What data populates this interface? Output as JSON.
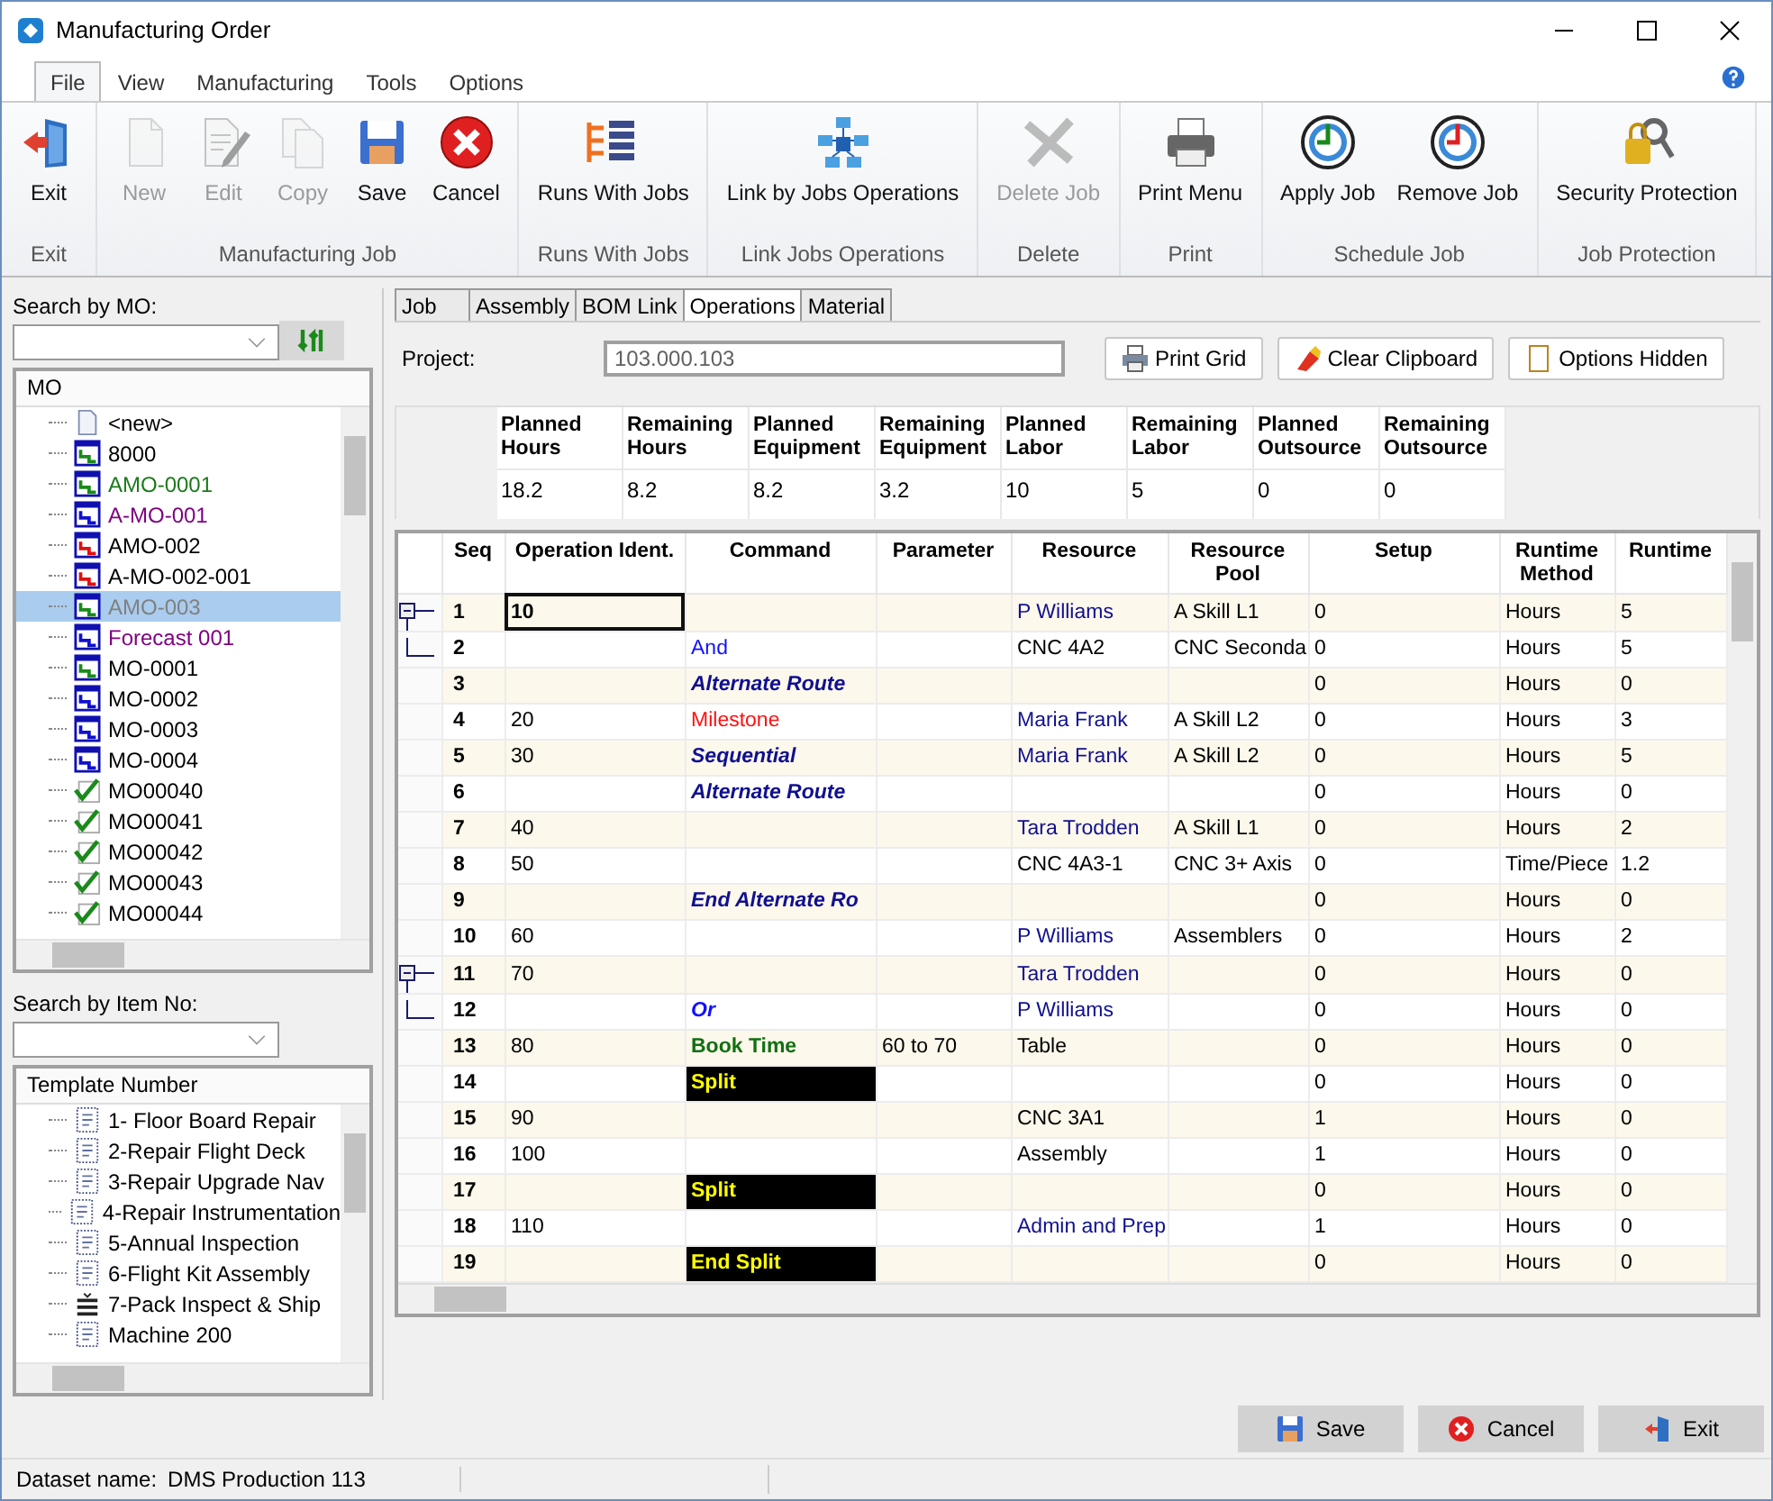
{
  "window": {
    "title": "Manufacturing Order"
  },
  "ribbon_tabs": [
    {
      "label": "File",
      "selected": true
    },
    {
      "label": "View",
      "selected": false
    },
    {
      "label": "Manufacturing",
      "selected": false
    },
    {
      "label": "Tools",
      "selected": false
    },
    {
      "label": "Options",
      "selected": false
    }
  ],
  "ribbon_groups": [
    {
      "label": "Exit",
      "buttons": [
        {
          "label": "Exit",
          "disabled": false
        }
      ]
    },
    {
      "label": "Manufacturing Job",
      "buttons": [
        {
          "label": "New",
          "disabled": true
        },
        {
          "label": "Edit",
          "disabled": true
        },
        {
          "label": "Copy",
          "disabled": true
        },
        {
          "label": "Save",
          "disabled": false
        },
        {
          "label": "Cancel",
          "disabled": false
        }
      ]
    },
    {
      "label": "Runs With Jobs",
      "buttons": [
        {
          "label": "Runs With Jobs",
          "disabled": false
        }
      ]
    },
    {
      "label": "Link Jobs Operations",
      "buttons": [
        {
          "label": "Link by Jobs Operations",
          "disabled": false
        }
      ]
    },
    {
      "label": "Delete",
      "buttons": [
        {
          "label": "Delete Job",
          "disabled": true
        }
      ]
    },
    {
      "label": "Print",
      "buttons": [
        {
          "label": "Print Menu",
          "disabled": false
        }
      ]
    },
    {
      "label": "Schedule Job",
      "buttons": [
        {
          "label": "Apply Job",
          "disabled": false
        },
        {
          "label": "Remove Job",
          "disabled": false
        }
      ]
    },
    {
      "label": "Job Protection",
      "buttons": [
        {
          "label": "Security Protection",
          "disabled": false
        }
      ]
    }
  ],
  "mo_search": {
    "label": "Search by MO:"
  },
  "mo_tree": {
    "header": "MO",
    "items": [
      {
        "label": "<new>",
        "kind": "new",
        "color": "#000000",
        "selected": false
      },
      {
        "label": "8000",
        "kind": "green",
        "color": "#000000",
        "selected": false
      },
      {
        "label": "AMO-0001",
        "kind": "green",
        "color": "#1a7a1a",
        "selected": false
      },
      {
        "label": "A-MO-001",
        "kind": "blue",
        "color": "#800080",
        "selected": false
      },
      {
        "label": "AMO-002",
        "kind": "red",
        "color": "#000000",
        "selected": false
      },
      {
        "label": "A-MO-002-001",
        "kind": "red",
        "color": "#000000",
        "selected": false
      },
      {
        "label": "AMO-003",
        "kind": "green",
        "color": "#808080",
        "selected": true
      },
      {
        "label": "Forecast 001",
        "kind": "blue",
        "color": "#800080",
        "selected": false
      },
      {
        "label": "MO-0001",
        "kind": "green",
        "color": "#000000",
        "selected": false
      },
      {
        "label": "MO-0002",
        "kind": "blue",
        "color": "#000000",
        "selected": false
      },
      {
        "label": "MO-0003",
        "kind": "blue",
        "color": "#000000",
        "selected": false
      },
      {
        "label": "MO-0004",
        "kind": "blue",
        "color": "#000000",
        "selected": false
      },
      {
        "label": "MO00040",
        "kind": "done",
        "color": "#000000",
        "selected": false
      },
      {
        "label": "MO00041",
        "kind": "done",
        "color": "#000000",
        "selected": false
      },
      {
        "label": "MO00042",
        "kind": "done",
        "color": "#000000",
        "selected": false
      },
      {
        "label": "MO00043",
        "kind": "done",
        "color": "#000000",
        "selected": false
      },
      {
        "label": "MO00044",
        "kind": "done",
        "color": "#000000",
        "selected": false
      }
    ]
  },
  "item_search": {
    "label": "Search by Item No:"
  },
  "template_tree": {
    "header": "Template Number",
    "items": [
      {
        "label": "1- Floor Board Repair",
        "kind": "template"
      },
      {
        "label": "2-Repair Flight Deck",
        "kind": "template"
      },
      {
        "label": "3-Repair Upgrade Nav",
        "kind": "template"
      },
      {
        "label": "4-Repair Instrumentation",
        "kind": "template"
      },
      {
        "label": "5-Annual Inspection",
        "kind": "template"
      },
      {
        "label": "6-Flight Kit Assembly",
        "kind": "template"
      },
      {
        "label": "7-Pack Inspect & Ship",
        "kind": "pack"
      },
      {
        "label": "Machine 200",
        "kind": "template"
      }
    ]
  },
  "tabs": [
    {
      "label": "Job",
      "selected": false
    },
    {
      "label": "Assembly",
      "selected": false
    },
    {
      "label": "BOM Link",
      "selected": false
    },
    {
      "label": "Operations",
      "selected": true
    },
    {
      "label": "Material",
      "selected": false
    }
  ],
  "project": {
    "label": "Project:",
    "value": "103.000.103"
  },
  "tool_buttons": [
    "Print Grid",
    "Clear Clipboard",
    "Options Hidden"
  ],
  "summary": [
    {
      "header": "Planned Hours",
      "value": "18.2"
    },
    {
      "header": "Remaining Hours",
      "value": "8.2"
    },
    {
      "header": "Planned Equipment",
      "value": "8.2"
    },
    {
      "header": "Remaining Equipment",
      "value": "3.2"
    },
    {
      "header": "Planned Labor",
      "value": "10"
    },
    {
      "header": "Remaining Labor",
      "value": "5"
    },
    {
      "header": "Planned Outsource",
      "value": "0"
    },
    {
      "header": "Remaining Outsource",
      "value": "0"
    }
  ],
  "grid": {
    "columns": [
      "Seq",
      "Operation Ident.",
      "Command",
      "Parameter",
      "Resource",
      "Resource Pool",
      "Setup",
      "Runtime Method",
      "Runtime"
    ],
    "rows": [
      {
        "seq": "1",
        "op": "10",
        "resource": {
          "text": "P Williams",
          "kind": "person"
        },
        "pool": "A Skill L1",
        "setup": "0",
        "method": "Hours",
        "runtime": "5",
        "kind": "parent",
        "selected": true
      },
      {
        "seq": "2",
        "command": {
          "text": "And",
          "kind": "link"
        },
        "resource": {
          "text": "CNC 4A2",
          "kind": "machine"
        },
        "pool": "CNC Seconda",
        "setup": "0",
        "method": "Hours",
        "runtime": "5",
        "kind": "child",
        "selected": false
      },
      {
        "seq": "3",
        "command": {
          "text": "Alternate Route",
          "kind": "route"
        },
        "setup": "0",
        "method": "Hours",
        "runtime": "0",
        "selected": false
      },
      {
        "seq": "4",
        "op": "20",
        "command": {
          "text": "Milestone",
          "kind": "milestone"
        },
        "resource": {
          "text": "Maria Frank",
          "kind": "person"
        },
        "pool": "A Skill L2",
        "setup": "0",
        "method": "Hours",
        "runtime": "3",
        "selected": false
      },
      {
        "seq": "5",
        "op": "30",
        "command": {
          "text": "Sequential",
          "kind": "route"
        },
        "resource": {
          "text": "Maria Frank",
          "kind": "person"
        },
        "pool": "A Skill L2",
        "setup": "0",
        "method": "Hours",
        "runtime": "5",
        "selected": false
      },
      {
        "seq": "6",
        "command": {
          "text": "Alternate Route",
          "kind": "route"
        },
        "setup": "0",
        "method": "Hours",
        "runtime": "0",
        "selected": false
      },
      {
        "seq": "7",
        "op": "40",
        "resource": {
          "text": "Tara Trodden",
          "kind": "person"
        },
        "pool": "A Skill L1",
        "setup": "0",
        "method": "Hours",
        "runtime": "2",
        "selected": false
      },
      {
        "seq": "8",
        "op": "50",
        "resource": {
          "text": "CNC 4A3-1",
          "kind": "machine"
        },
        "pool": "CNC 3+ Axis",
        "setup": "0",
        "method": "Time/Piece",
        "runtime": "1.2",
        "selected": false
      },
      {
        "seq": "9",
        "command": {
          "text": "End Alternate Ro",
          "kind": "route"
        },
        "setup": "0",
        "method": "Hours",
        "runtime": "0",
        "selected": false
      },
      {
        "seq": "10",
        "op": "60",
        "resource": {
          "text": "P Williams",
          "kind": "person"
        },
        "pool": "Assemblers",
        "setup": "0",
        "method": "Hours",
        "runtime": "2",
        "selected": false
      },
      {
        "seq": "11",
        "op": "70",
        "resource": {
          "text": "Tara Trodden",
          "kind": "person"
        },
        "setup": "0",
        "method": "Hours",
        "runtime": "0",
        "kind": "parent",
        "selected": false
      },
      {
        "seq": "12",
        "command": {
          "text": "Or",
          "kind": "or"
        },
        "resource": {
          "text": "P Williams",
          "kind": "person"
        },
        "setup": "0",
        "method": "Hours",
        "runtime": "0",
        "kind": "child",
        "selected": false
      },
      {
        "seq": "13",
        "op": "80",
        "command": {
          "text": "Book Time",
          "kind": "booktime"
        },
        "parameter": "60 to 70",
        "resource": {
          "text": "Table",
          "kind": "machine"
        },
        "setup": "0",
        "method": "Hours",
        "runtime": "0",
        "selected": false
      },
      {
        "seq": "14",
        "command": {
          "text": "Split",
          "kind": "split"
        },
        "setup": "0",
        "method": "Hours",
        "runtime": "0",
        "selected": false
      },
      {
        "seq": "15",
        "op": "90",
        "resource": {
          "text": "CNC 3A1",
          "kind": "machine"
        },
        "setup": "1",
        "method": "Hours",
        "runtime": "0",
        "selected": false
      },
      {
        "seq": "16",
        "op": "100",
        "resource": {
          "text": "Assembly",
          "kind": "machine"
        },
        "setup": "1",
        "method": "Hours",
        "runtime": "0",
        "selected": false
      },
      {
        "seq": "17",
        "command": {
          "text": "Split",
          "kind": "split"
        },
        "setup": "0",
        "method": "Hours",
        "runtime": "0",
        "selected": false
      },
      {
        "seq": "18",
        "op": "110",
        "resource": {
          "text": "Admin and Prep",
          "kind": "person"
        },
        "setup": "1",
        "method": "Hours",
        "runtime": "0",
        "selected": false
      },
      {
        "seq": "19",
        "command": {
          "text": "End Split",
          "kind": "split"
        },
        "setup": "0",
        "method": "Hours",
        "runtime": "0",
        "selected": false
      }
    ]
  },
  "footer_buttons": [
    "Save",
    "Cancel",
    "Exit"
  ],
  "status_bar": {
    "label": "Dataset name:",
    "value": "DMS Production 113"
  }
}
